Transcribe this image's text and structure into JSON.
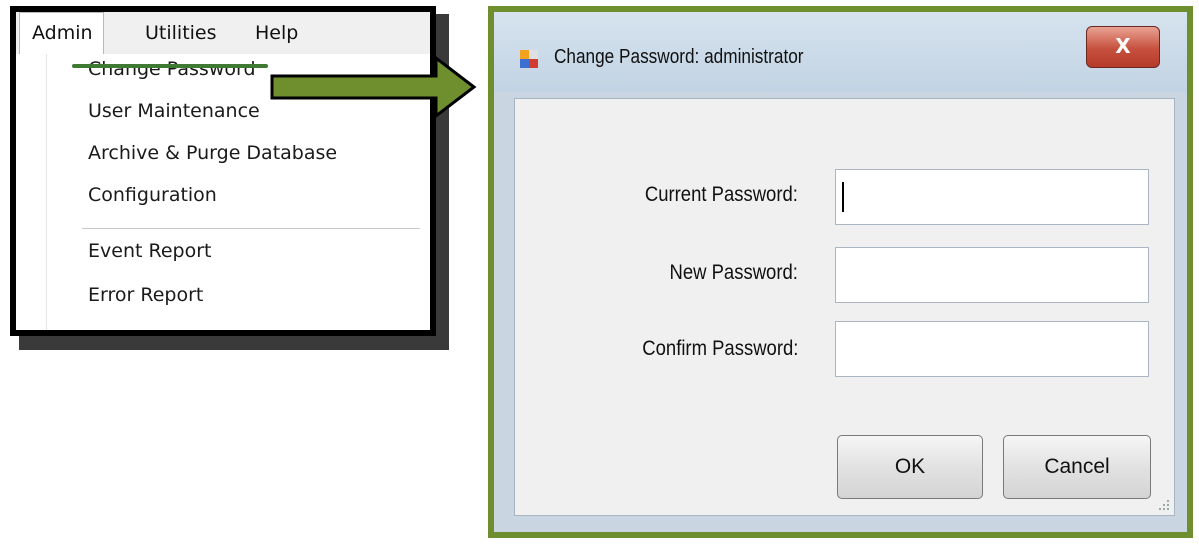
{
  "menu": {
    "menubar": [
      "Admin",
      "Utilities",
      "Help"
    ],
    "items": [
      {
        "label": "Change Password"
      },
      {
        "label": "User Maintenance"
      },
      {
        "label": "Archive & Purge Database"
      },
      {
        "label": "Configuration"
      },
      {
        "label": "Event Report"
      },
      {
        "label": "Error Report"
      }
    ]
  },
  "dialog": {
    "title": "Change Password: administrator",
    "close_glyph": "X",
    "fields": [
      {
        "label": "Current Password:",
        "value": ""
      },
      {
        "label": "New Password:",
        "value": ""
      },
      {
        "label": "Confirm Password:",
        "value": ""
      }
    ],
    "ok_label": "OK",
    "cancel_label": "Cancel"
  },
  "colors": {
    "highlight_green": "#3f7a33",
    "dialog_border": "#6f8f2f",
    "close_red": "#c6503e"
  },
  "icons": [
    "app-window-icon",
    "close-icon",
    "arrow-right-icon",
    "resize-grip-icon"
  ]
}
